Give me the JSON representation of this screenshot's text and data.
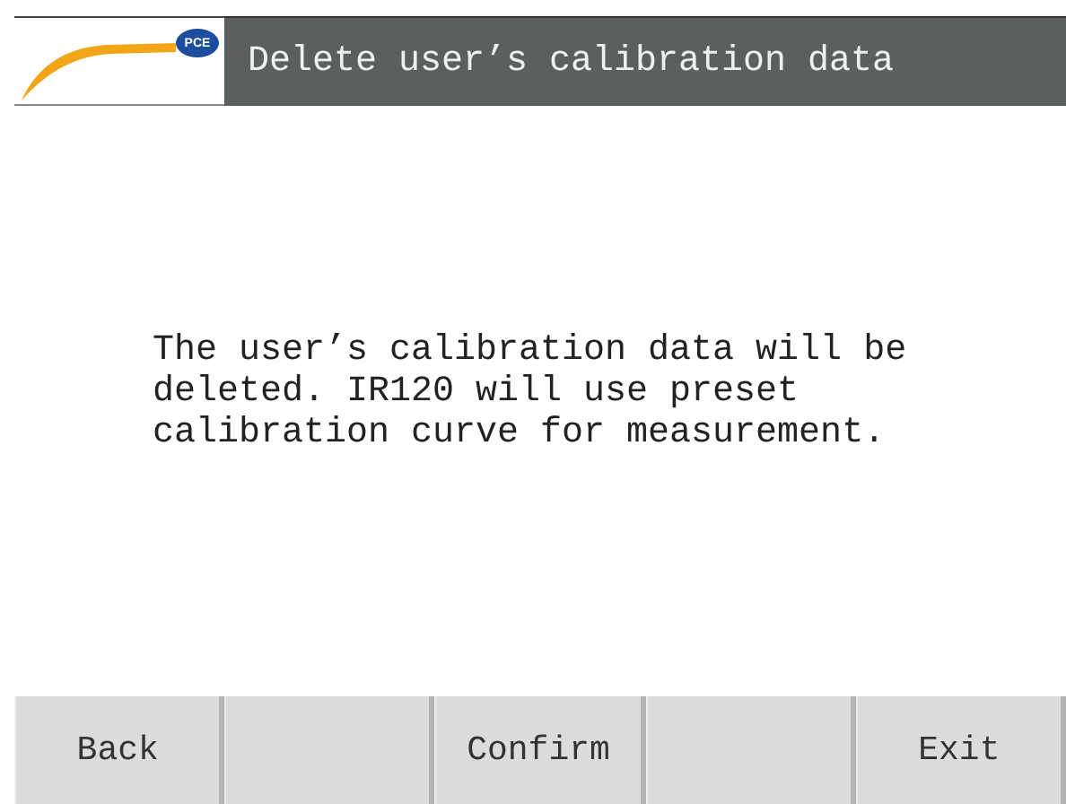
{
  "header": {
    "logo_text": "PCE",
    "title": "Delete user’s calibration data"
  },
  "message": "The user’s calibration data will be deleted. IR120 will use preset calibration curve for measurement.",
  "buttons": [
    {
      "kind": "key",
      "label": "Back"
    },
    {
      "kind": "blank"
    },
    {
      "kind": "key",
      "label": "Confirm"
    },
    {
      "kind": "blank"
    },
    {
      "kind": "key",
      "label": "Exit"
    }
  ]
}
